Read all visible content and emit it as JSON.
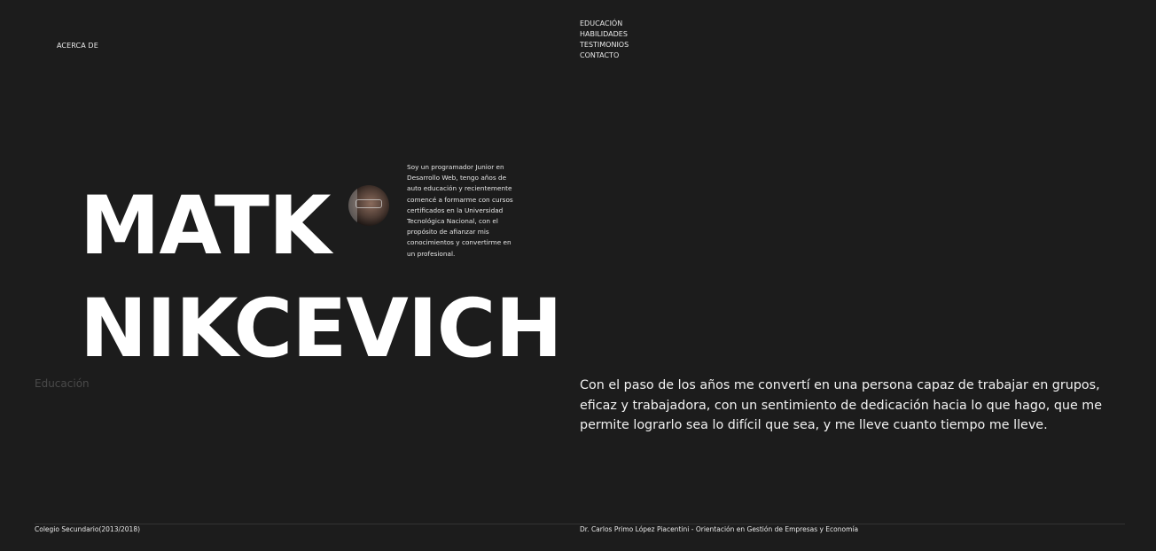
{
  "header": {
    "about_link": "ACERCA DE",
    "nav": [
      {
        "label": "EDUCACIÓN"
      },
      {
        "label": "HABILIDADES"
      },
      {
        "label": "TESTIMONIOS"
      },
      {
        "label": "CONTACTO"
      }
    ]
  },
  "hero": {
    "first_name": "MATK",
    "last_name": "NIKCEVICH",
    "bio": "Soy un programador Junior en Desarrollo Web, tengo años de auto educación y recientemente comencé a formarme con cursos certificados en la Universidad Tecnológica Nacional, con el propósito de afianzar mis conocimientos y convertirme en un profesional."
  },
  "education": {
    "section_label": "Educación",
    "statement": "Con el paso de los años me convertí en una persona capaz de trabajar en grupos, eficaz y trabajadora, con un sentimiento de dedicación hacia lo que hago, que me permite lograrlo sea lo difícil que sea, y me lleve cuanto tiempo me lleve.",
    "entries": [
      {
        "period": "Colegio Secundario(2013/2018)",
        "school": "Dr. Carlos Primo López Piacentini - Orientación en Gestión de Empresas y Economía"
      }
    ]
  }
}
